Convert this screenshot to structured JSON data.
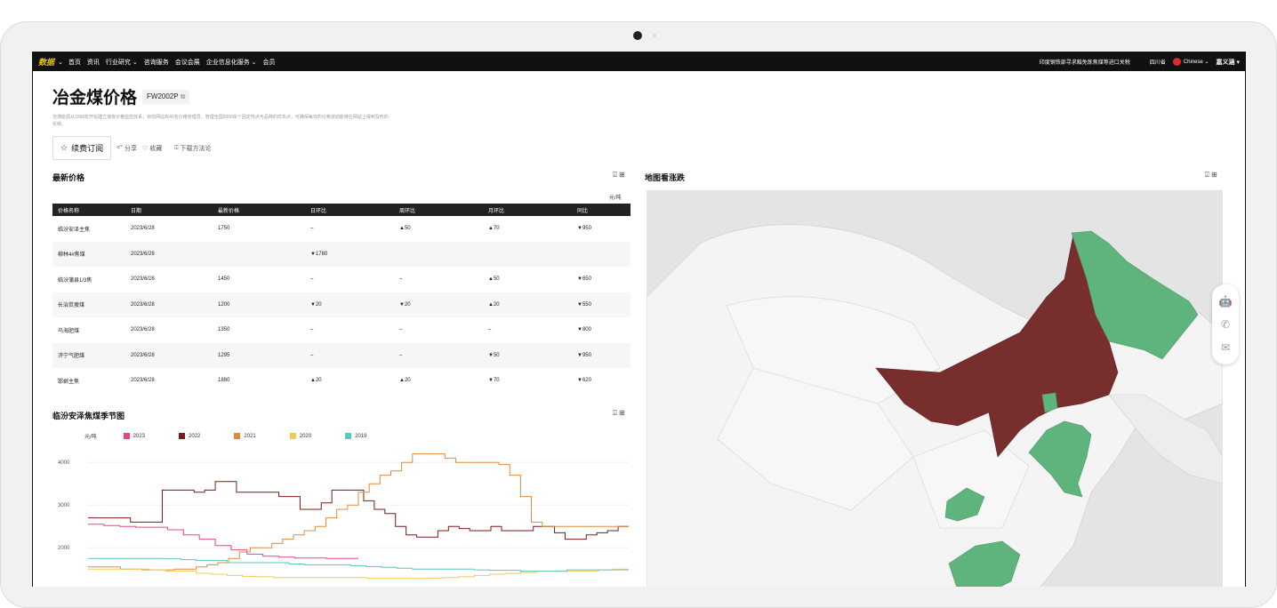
{
  "nav": {
    "logo": "数据",
    "items": [
      "首页",
      "资讯",
      "行业研究 ⌄",
      "咨询服务",
      "会议会展",
      "企业信息化服务 ⌄",
      "会员"
    ],
    "notice": "印度钢铁部寻求豁免炼焦煤等进口关税",
    "region": "四川省",
    "language": "Chinese ⌄",
    "user": "嘉义涵 ▾"
  },
  "header": {
    "title": "冶金煤价格",
    "code": "FW2002P",
    "description": "汾渭能源从1998年开始建立煤炭价格监控体系，目前网站有40名价格管理员，管理全国2000余个固定地点与品种的样本点，可确保每日的价格波动能够在网站上得到及时的反映。",
    "subscribe_label": "续费订阅",
    "share_label": "分享",
    "favorite_label": "收藏",
    "download_label": "下载方法论"
  },
  "latest_prices": {
    "title": "最新价格",
    "unit": "元/吨",
    "columns": [
      "价格名称",
      "日期",
      "最新价格",
      "日环比",
      "周环比",
      "月环比",
      "同比"
    ],
    "rows": [
      {
        "name": "临汾安泽主焦",
        "date": "2023/6/28",
        "price": "1750",
        "day": "–",
        "week": "▲50",
        "month": "▲70",
        "year": "▼950"
      },
      {
        "name": "柳林4#焦煤",
        "date": "2023/6/28",
        "price": "",
        "day": "▼1780",
        "week": "",
        "month": "",
        "year": ""
      },
      {
        "name": "临汾蒲县1/3焦",
        "date": "2023/6/28",
        "price": "1450",
        "day": "–",
        "week": "–",
        "month": "▲50",
        "year": "▼650"
      },
      {
        "name": "长治贫瘦煤",
        "date": "2023/6/28",
        "price": "1200",
        "day": "▼20",
        "week": "▼20",
        "month": "▲20",
        "year": "▼550"
      },
      {
        "name": "乌海肥煤",
        "date": "2023/6/28",
        "price": "1350",
        "day": "–",
        "week": "–",
        "month": "–",
        "year": "▼800"
      },
      {
        "name": "济宁气肥煤",
        "date": "2023/6/28",
        "price": "1295",
        "day": "–",
        "week": "–",
        "month": "▼50",
        "year": "▼950"
      },
      {
        "name": "邯郸主焦",
        "date": "2023/6/28",
        "price": "1880",
        "day": "▲20",
        "week": "▲20",
        "month": "▼70",
        "year": "▼620"
      }
    ]
  },
  "map": {
    "title": "地图看涨跌"
  },
  "seasonal": {
    "title": "临汾安泽焦煤季节图"
  },
  "chart_data": {
    "type": "line",
    "title": "临汾安泽焦煤季节图",
    "ylabel": "元/吨",
    "ylim": [
      900,
      4400
    ],
    "yticks": [
      1000,
      2000,
      3000,
      4000
    ],
    "legend_position": "top-left",
    "grid": true,
    "series": [
      {
        "name": "2023",
        "color": "#e8457f",
        "values": [
          2550,
          2520,
          2500,
          2480,
          2480,
          2420,
          2300,
          2200,
          2050,
          1950,
          1850,
          1800,
          1780,
          1760,
          1760,
          1750,
          1750,
          1750
        ]
      },
      {
        "name": "2022",
        "color": "#7a1a1a",
        "values": [
          2700,
          2700,
          2700,
          2700,
          2600,
          2600,
          2600,
          3350,
          3350,
          3350,
          3300,
          3350,
          3550,
          3550,
          3300,
          3300,
          3300,
          3300,
          3200,
          3200,
          2900,
          2900,
          3050,
          3350,
          3350,
          3350,
          3100,
          2900,
          2800,
          2500,
          2300,
          2250,
          2250,
          2400,
          2500,
          2450,
          2400,
          2400,
          2500,
          2400,
          2400,
          2400,
          2500,
          2500,
          2350,
          2200,
          2200,
          2300,
          2350,
          2400,
          2500,
          2500
        ]
      },
      {
        "name": "2021",
        "color": "#e08a3c",
        "values": [
          1550,
          1550,
          1550,
          1500,
          1500,
          1480,
          1480,
          1480,
          1500,
          1500,
          1550,
          1600,
          1650,
          1750,
          1900,
          2000,
          2000,
          2100,
          2200,
          2300,
          2400,
          2500,
          2700,
          2900,
          3000,
          3300,
          3500,
          3700,
          3800,
          4000,
          4200,
          4200,
          4200,
          4100,
          4000,
          4000,
          4000,
          4000,
          3950,
          3700,
          3200,
          2600,
          2500,
          2500,
          2500,
          2500,
          2500,
          2500,
          2500,
          2500,
          2500
        ]
      },
      {
        "name": "2020",
        "color": "#f0c95a",
        "values": [
          1500,
          1500,
          1500,
          1500,
          1480,
          1450,
          1450,
          1400,
          1380,
          1350,
          1330,
          1320,
          1300,
          1300,
          1300,
          1300,
          1300,
          1300,
          1280,
          1280,
          1280,
          1280,
          1290,
          1300,
          1320,
          1350,
          1380,
          1400,
          1420,
          1450,
          1450,
          1450,
          1450,
          1480,
          1500,
          1500
        ]
      },
      {
        "name": "2019",
        "color": "#5cc6c0",
        "values": [
          1750,
          1750,
          1750,
          1750,
          1750,
          1740,
          1720,
          1700,
          1700,
          1650,
          1650,
          1650,
          1650,
          1620,
          1600,
          1600,
          1600,
          1580,
          1560,
          1540,
          1520,
          1500,
          1500,
          1500,
          1500,
          1480,
          1470,
          1470,
          1450,
          1450,
          1450,
          1480,
          1480,
          1480,
          1480,
          1480
        ]
      }
    ]
  },
  "colors": {
    "rise": "#772e2c",
    "fall": "#5fb37d",
    "neutral": "#f7f7f7",
    "accent_logo": "#f2c400"
  },
  "float_bar": {
    "icons": [
      "robot-icon",
      "phone-icon",
      "mail-icon"
    ]
  }
}
